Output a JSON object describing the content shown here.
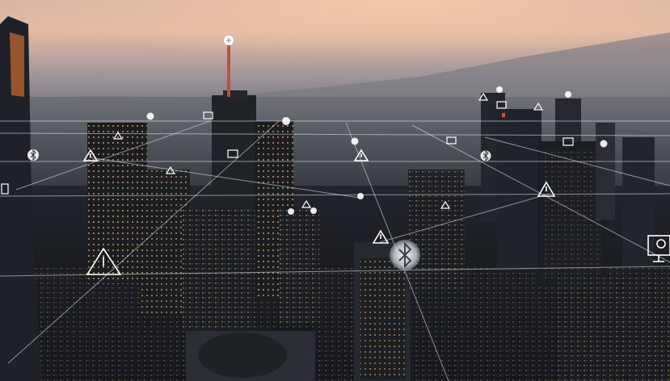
{
  "scene": {
    "description_label": "",
    "sky_colors": [
      "#f1c6a8",
      "#b6a7a8",
      "#6f7076",
      "#3b3f45"
    ],
    "haze_color": "#5b6068",
    "city_dark": "#15181d",
    "window_glow": "#e8a859",
    "hud_line_color": "#e8eef4",
    "hud_icon_color": "#ffffff",
    "beacon_color": "#ff4a4a"
  },
  "hud_icons": [
    {
      "name": "bluetooth-icon",
      "type": "bluetooth"
    },
    {
      "name": "warning-icon",
      "type": "warning"
    },
    {
      "name": "info-dot-icon",
      "type": "dot"
    },
    {
      "name": "gauge-icon",
      "type": "gauge"
    },
    {
      "name": "pie-chart-monitor-icon",
      "type": "monitor"
    },
    {
      "name": "bluetooth-bubble-icon",
      "type": "bluetooth-large"
    }
  ]
}
